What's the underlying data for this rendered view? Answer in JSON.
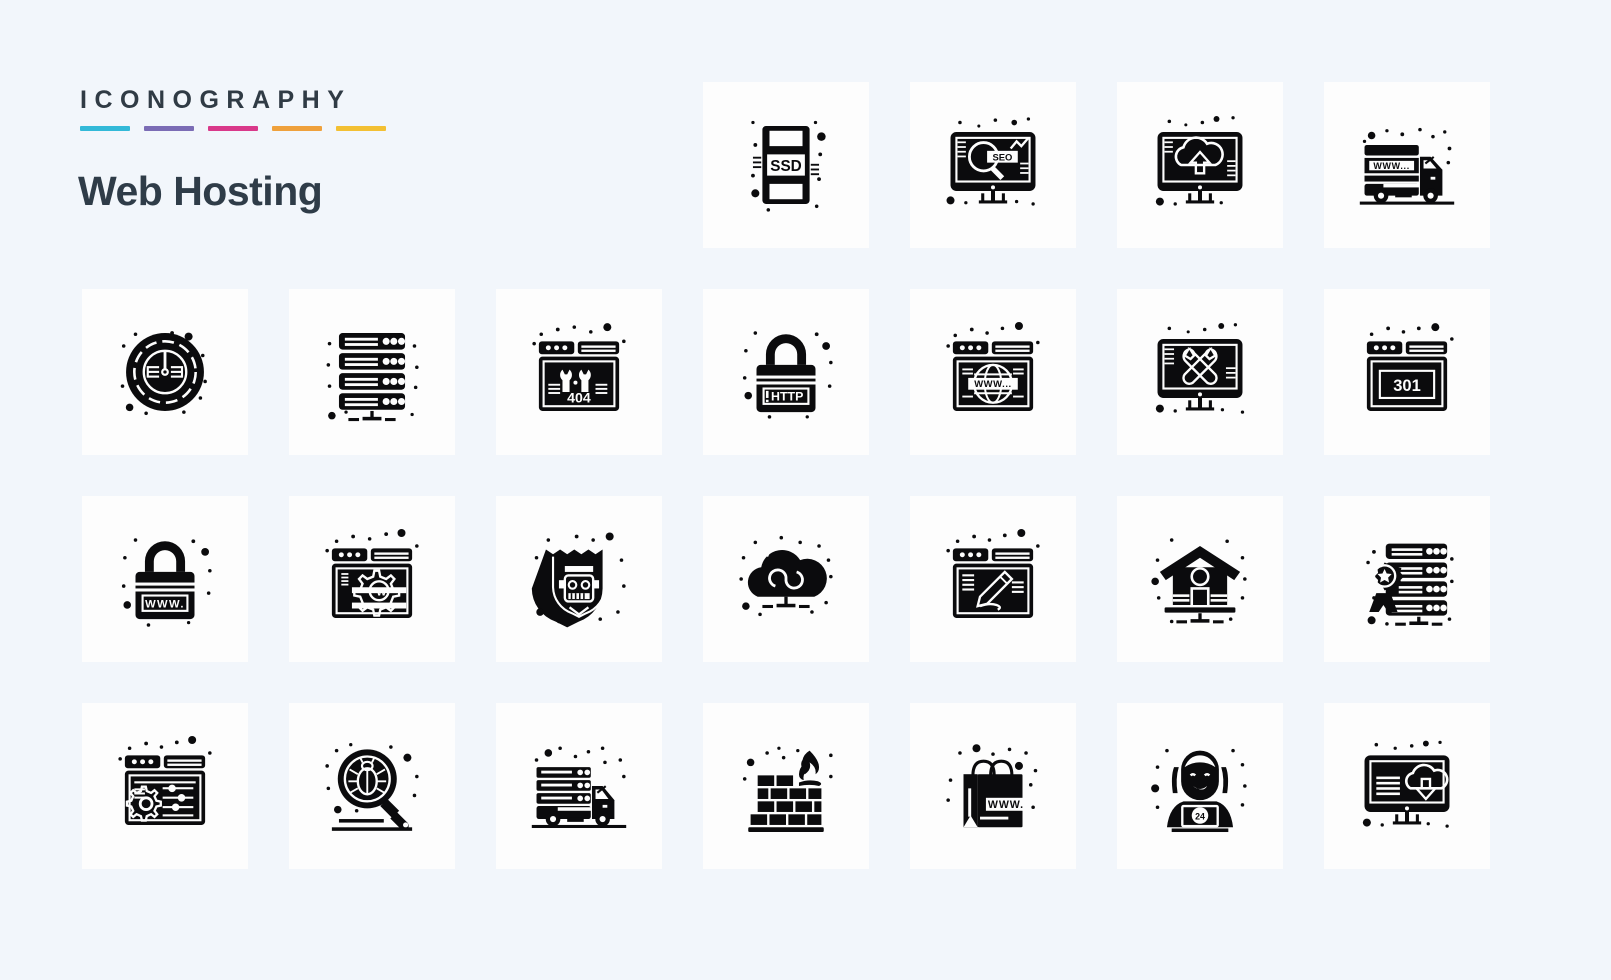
{
  "header": {
    "kicker": "ICONOGRAPHY",
    "title": "Web Hosting",
    "rule_colors": [
      "#33b9d8",
      "#7b6cb5",
      "#d9398a",
      "#efa13c",
      "#f3c033"
    ]
  },
  "page": {
    "background": "#f2f6fb",
    "tile_background": "#fdfdfd",
    "glyph_color": "#0b0b0d",
    "columns": 7,
    "rows": 4,
    "icon_count": 25
  },
  "icons": [
    {
      "slot": 1,
      "name": "empty-slot",
      "label": "",
      "inline_text": ""
    },
    {
      "slot": 2,
      "name": "empty-slot",
      "label": "",
      "inline_text": ""
    },
    {
      "slot": 3,
      "name": "empty-slot",
      "label": "",
      "inline_text": ""
    },
    {
      "slot": 4,
      "name": "ssd-drive-icon",
      "label": "SSD Storage",
      "inline_text": "SSD"
    },
    {
      "slot": 5,
      "name": "seo-monitor-icon",
      "label": "SEO Monitor",
      "inline_text": "SEO"
    },
    {
      "slot": 6,
      "name": "cloud-upload-monitor-icon",
      "label": "Cloud Upload",
      "inline_text": ""
    },
    {
      "slot": 7,
      "name": "www-delivery-truck-icon",
      "label": "Domain Delivery",
      "inline_text": "WWW..."
    },
    {
      "slot": 8,
      "name": "speed-gauge-icon",
      "label": "Speed Gauge",
      "inline_text": ""
    },
    {
      "slot": 9,
      "name": "server-rack-icon",
      "label": "Server Rack",
      "inline_text": ""
    },
    {
      "slot": 10,
      "name": "browser-404-error-icon",
      "label": "404 Error Page",
      "inline_text": "404"
    },
    {
      "slot": 11,
      "name": "http-padlock-icon",
      "label": "HTTP Security",
      "inline_text": "HTTP"
    },
    {
      "slot": 12,
      "name": "www-globe-browser-icon",
      "label": "World Wide Web",
      "inline_text": "WWW..."
    },
    {
      "slot": 13,
      "name": "monitor-tools-icon",
      "label": "Maintenance Monitor",
      "inline_text": ""
    },
    {
      "slot": 14,
      "name": "browser-301-redirect-icon",
      "label": "301 Redirect",
      "inline_text": "301"
    },
    {
      "slot": 15,
      "name": "www-padlock-icon",
      "label": "Secure Domain",
      "inline_text": "WWW."
    },
    {
      "slot": 16,
      "name": "browser-gear-w-icon",
      "label": "Web Configuration",
      "inline_text": "W"
    },
    {
      "slot": 17,
      "name": "robot-shield-icon",
      "label": "Bot Protection",
      "inline_text": ""
    },
    {
      "slot": 18,
      "name": "unlimited-cloud-icon",
      "label": "Unlimited Cloud",
      "inline_text": ""
    },
    {
      "slot": 19,
      "name": "browser-pencil-icon",
      "label": "Web Design",
      "inline_text": ""
    },
    {
      "slot": 20,
      "name": "home-hosting-icon",
      "label": "Home Hosting",
      "inline_text": ""
    },
    {
      "slot": 21,
      "name": "premium-server-award-icon",
      "label": "Premium Server",
      "inline_text": ""
    },
    {
      "slot": 22,
      "name": "browser-settings-icon",
      "label": "Browser Settings",
      "inline_text": ""
    },
    {
      "slot": 23,
      "name": "bug-search-icon",
      "label": "Malware Scan",
      "inline_text": ""
    },
    {
      "slot": 24,
      "name": "server-migration-truck-icon",
      "label": "Server Migration",
      "inline_text": ""
    },
    {
      "slot": 25,
      "name": "firewall-icon",
      "label": "Firewall",
      "inline_text": ""
    },
    {
      "slot": 26,
      "name": "ecommerce-www-bag-icon",
      "label": "E-commerce Hosting",
      "inline_text": "WWW."
    },
    {
      "slot": 27,
      "name": "support-24-agent-icon",
      "label": "24/7 Support",
      "inline_text": "24"
    },
    {
      "slot": 28,
      "name": "cloud-download-monitor-icon",
      "label": "Cloud Download",
      "inline_text": ""
    }
  ]
}
